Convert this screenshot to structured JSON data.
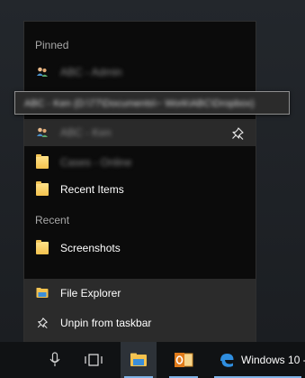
{
  "jumplist": {
    "pinned_title": "Pinned",
    "pinned_items": [
      {
        "label": "ABC - Admin",
        "icon": "network-users-icon",
        "blurred": true
      },
      {
        "label": "ABC - Ken",
        "icon": "network-users-icon",
        "blurred": true
      },
      {
        "label": "Cases - Online",
        "icon": "folder-icon",
        "blurred": true
      },
      {
        "label": "Recent Items",
        "icon": "folder-icon",
        "blurred": false
      }
    ],
    "recent_title": "Recent",
    "recent_items": [
      {
        "label": "Screenshots",
        "icon": "folder-icon"
      }
    ],
    "tasks": [
      {
        "label": "File Explorer",
        "icon": "file-explorer-icon"
      },
      {
        "label": "Unpin from taskbar",
        "icon": "unpin-icon"
      }
    ]
  },
  "tooltip": {
    "text": "ABC - Ken (D:\\77\\Documents\\~ Work\\ABC\\Dropbox)"
  },
  "taskbar": {
    "window_label": "Windows 10 - ",
    "icons": [
      "microphone-icon",
      "task-view-icon",
      "file-explorer-icon",
      "outlook-icon",
      "edge-icon"
    ]
  },
  "colors": {
    "panel_bg": "#0b0b0b",
    "tasks_bg": "#2b2b2b",
    "hover_bg": "#2a2a2a",
    "taskbar_bg": "#101214",
    "accent": "#7fb3e6"
  }
}
